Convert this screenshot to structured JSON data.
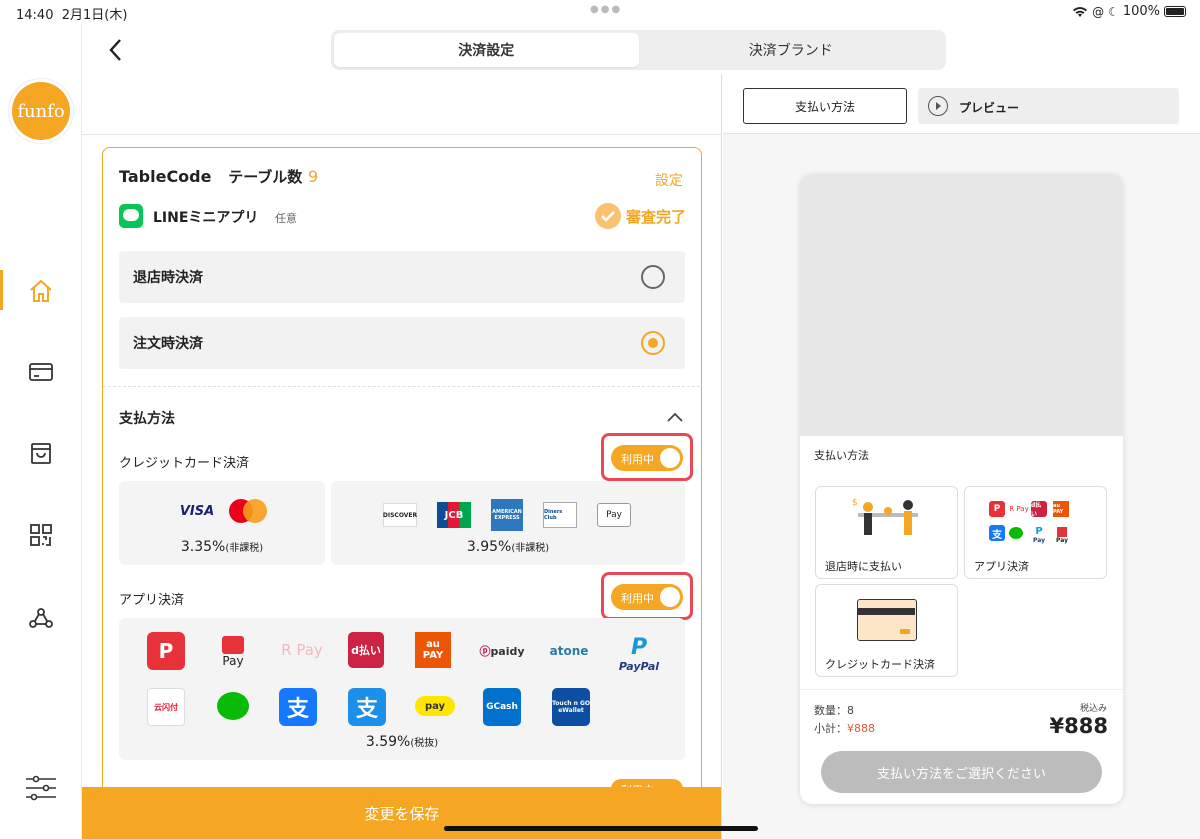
{
  "status_bar": {
    "time": "14:40",
    "date": "2月1日(木)",
    "battery": "100%"
  },
  "sidebar": {
    "logo_text": "funfo"
  },
  "header": {
    "tabs": [
      {
        "label": "決済設定"
      },
      {
        "label": "決済ブランド"
      }
    ]
  },
  "card": {
    "title": "TableCode",
    "table_count_label": "テーブル数",
    "table_count": "9",
    "settings_link": "設定",
    "line_label": "LINEミニアプリ",
    "line_optional": "任意",
    "review_status": "審査完了",
    "options": [
      {
        "label": "退店時決済",
        "selected": false
      },
      {
        "label": "注文時決済",
        "selected": true
      }
    ],
    "payment_section_title": "支払方法",
    "credit": {
      "title": "クレジットカード決済",
      "toggle": "利用中",
      "group1_rate": "3.35%",
      "group1_tax": "(非課税)",
      "group2_rate": "3.95%",
      "group2_tax": "(非課税)",
      "group1_brands": [
        "VISA",
        "mastercard-icon"
      ],
      "group2_brands": [
        "DISCOVER",
        "JCB",
        "AMERICAN EXPRESS",
        "Diners Club",
        "Pay"
      ]
    },
    "app": {
      "title": "アプリ決済",
      "toggle": "利用中",
      "rate": "3.59%",
      "tax": "(税抜)",
      "brands_row1": [
        "paypay-icon",
        "Pay",
        "R Pay",
        "d払い",
        "au PAY",
        "paidy",
        "atone",
        "PayPal"
      ],
      "brands_row2": [
        "云闪付",
        "wechat-icon",
        "支",
        "支",
        "pay",
        "GCash",
        "Touch n GO eWallet"
      ]
    },
    "partial_next_toggle": "利用中"
  },
  "save_button": "変更を保存",
  "right": {
    "pay_method_button": "支払い方法",
    "preview_button": "プレビュー",
    "phone": {
      "section_title": "支払い方法",
      "methods": [
        {
          "label": "退店時に支払い"
        },
        {
          "label": "アプリ決済"
        },
        {
          "label": "クレジットカード決済"
        }
      ],
      "app_logos": [
        "R Pay",
        "d払い",
        "au PAY",
        "支",
        "Pay",
        "Pay"
      ],
      "quantity": "数量：8",
      "subtotal_label": "小計：",
      "subtotal": "¥888",
      "tax_incl": "税込み",
      "total": "¥888",
      "cta": "支払い方法をご選択ください"
    }
  },
  "colors": {
    "accent": "#f5a623",
    "highlight": "#e84a55"
  }
}
